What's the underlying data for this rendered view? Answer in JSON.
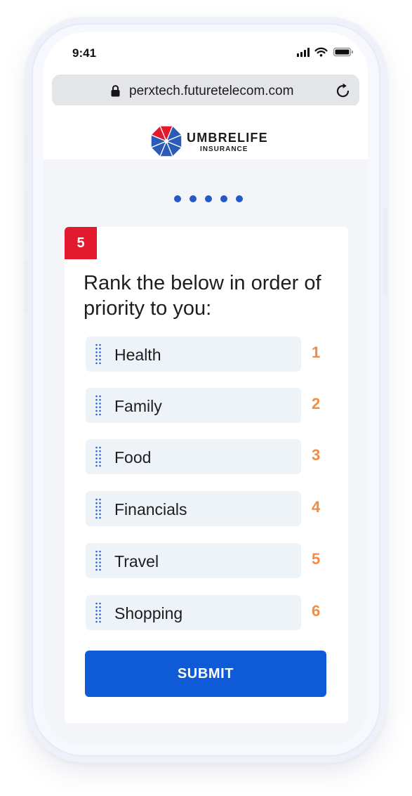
{
  "status_bar": {
    "time": "9:41"
  },
  "browser": {
    "url": "perxtech.futuretelecom.com"
  },
  "brand": {
    "name": "UMBRELIFE",
    "subtitle": "INSURANCE"
  },
  "progress": {
    "total_steps": 5
  },
  "question": {
    "number": "5",
    "text": "Rank the below in order of priority to you:"
  },
  "rank_items": [
    {
      "label": "Health",
      "rank": "1"
    },
    {
      "label": "Family",
      "rank": "2"
    },
    {
      "label": "Food",
      "rank": "3"
    },
    {
      "label": "Financials",
      "rank": "4"
    },
    {
      "label": "Travel",
      "rank": "5"
    },
    {
      "label": "Shopping",
      "rank": "6"
    }
  ],
  "submit_label": "SUBMIT",
  "colors": {
    "accent_blue": "#0f5ad6",
    "badge_red": "#e3192e",
    "rank_orange": "#f28c45",
    "item_background": "#eef3f7"
  },
  "icons": {
    "lock": "lock-icon",
    "reload": "reload-icon",
    "drag": "drag-handle-icon",
    "logo": "umbrella-logo-icon"
  }
}
